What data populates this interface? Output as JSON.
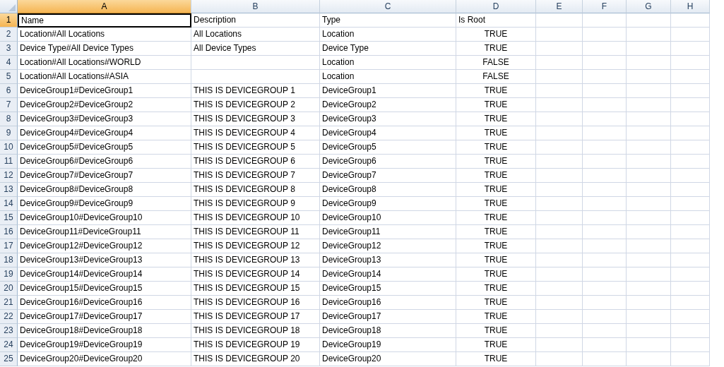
{
  "columns": [
    {
      "label": "A",
      "selected": true
    },
    {
      "label": "B",
      "selected": false
    },
    {
      "label": "C",
      "selected": false
    },
    {
      "label": "D",
      "selected": false
    },
    {
      "label": "E",
      "selected": false
    },
    {
      "label": "F",
      "selected": false
    },
    {
      "label": "G",
      "selected": false
    },
    {
      "label": "H",
      "selected": false
    }
  ],
  "rows": [
    {
      "number": "1",
      "selected": true,
      "cells": [
        "Name",
        "Description",
        "Type",
        "Is Root"
      ]
    },
    {
      "number": "2",
      "selected": false,
      "cells": [
        "Location#All Locations",
        "All Locations",
        "Location",
        "TRUE"
      ]
    },
    {
      "number": "3",
      "selected": false,
      "cells": [
        "Device Type#All Device Types",
        "All Device Types",
        "Device Type",
        "TRUE"
      ]
    },
    {
      "number": "4",
      "selected": false,
      "cells": [
        "Location#All Locations#WORLD",
        null,
        "Location",
        "FALSE"
      ]
    },
    {
      "number": "5",
      "selected": false,
      "cells": [
        "Location#All Locations#ASIA",
        null,
        "Location",
        "FALSE"
      ]
    },
    {
      "number": "6",
      "selected": false,
      "cells": [
        "DeviceGroup1#DeviceGroup1",
        "THIS IS DEVICEGROUP 1",
        "DeviceGroup1",
        "TRUE"
      ]
    },
    {
      "number": "7",
      "selected": false,
      "cells": [
        "DeviceGroup2#DeviceGroup2",
        "THIS IS DEVICEGROUP 2",
        "DeviceGroup2",
        "TRUE"
      ]
    },
    {
      "number": "8",
      "selected": false,
      "cells": [
        "DeviceGroup3#DeviceGroup3",
        "THIS IS DEVICEGROUP 3",
        "DeviceGroup3",
        "TRUE"
      ]
    },
    {
      "number": "9",
      "selected": false,
      "cells": [
        "DeviceGroup4#DeviceGroup4",
        "THIS IS DEVICEGROUP 4",
        "DeviceGroup4",
        "TRUE"
      ]
    },
    {
      "number": "10",
      "selected": false,
      "cells": [
        "DeviceGroup5#DeviceGroup5",
        "THIS IS DEVICEGROUP 5",
        "DeviceGroup5",
        "TRUE"
      ]
    },
    {
      "number": "11",
      "selected": false,
      "cells": [
        "DeviceGroup6#DeviceGroup6",
        "THIS IS DEVICEGROUP 6",
        "DeviceGroup6",
        "TRUE"
      ]
    },
    {
      "number": "12",
      "selected": false,
      "cells": [
        "DeviceGroup7#DeviceGroup7",
        "THIS IS DEVICEGROUP 7",
        "DeviceGroup7",
        "TRUE"
      ]
    },
    {
      "number": "13",
      "selected": false,
      "cells": [
        "DeviceGroup8#DeviceGroup8",
        "THIS IS DEVICEGROUP 8",
        "DeviceGroup8",
        "TRUE"
      ]
    },
    {
      "number": "14",
      "selected": false,
      "cells": [
        "DeviceGroup9#DeviceGroup9",
        "THIS IS DEVICEGROUP 9",
        "DeviceGroup9",
        "TRUE"
      ]
    },
    {
      "number": "15",
      "selected": false,
      "cells": [
        "DeviceGroup10#DeviceGroup10",
        "THIS IS DEVICEGROUP 10",
        "DeviceGroup10",
        "TRUE"
      ]
    },
    {
      "number": "16",
      "selected": false,
      "cells": [
        "DeviceGroup11#DeviceGroup11",
        "THIS IS DEVICEGROUP 11",
        "DeviceGroup11",
        "TRUE"
      ]
    },
    {
      "number": "17",
      "selected": false,
      "cells": [
        "DeviceGroup12#DeviceGroup12",
        "THIS IS DEVICEGROUP 12",
        "DeviceGroup12",
        "TRUE"
      ]
    },
    {
      "number": "18",
      "selected": false,
      "cells": [
        "DeviceGroup13#DeviceGroup13",
        "THIS IS DEVICEGROUP 13",
        "DeviceGroup13",
        "TRUE"
      ]
    },
    {
      "number": "19",
      "selected": false,
      "cells": [
        "DeviceGroup14#DeviceGroup14",
        "THIS IS DEVICEGROUP 14",
        "DeviceGroup14",
        "TRUE"
      ]
    },
    {
      "number": "20",
      "selected": false,
      "cells": [
        "DeviceGroup15#DeviceGroup15",
        "THIS IS DEVICEGROUP 15",
        "DeviceGroup15",
        "TRUE"
      ]
    },
    {
      "number": "21",
      "selected": false,
      "cells": [
        "DeviceGroup16#DeviceGroup16",
        "THIS IS DEVICEGROUP 16",
        "DeviceGroup16",
        "TRUE"
      ]
    },
    {
      "number": "22",
      "selected": false,
      "cells": [
        "DeviceGroup17#DeviceGroup17",
        "THIS IS DEVICEGROUP 17",
        "DeviceGroup17",
        "TRUE"
      ]
    },
    {
      "number": "23",
      "selected": false,
      "cells": [
        "DeviceGroup18#DeviceGroup18",
        "THIS IS DEVICEGROUP 18",
        "DeviceGroup18",
        "TRUE"
      ]
    },
    {
      "number": "24",
      "selected": false,
      "cells": [
        "DeviceGroup19#DeviceGroup19",
        "THIS IS DEVICEGROUP 19",
        "DeviceGroup19",
        "TRUE"
      ]
    },
    {
      "number": "25",
      "selected": false,
      "cells": [
        "DeviceGroup20#DeviceGroup20",
        "THIS IS DEVICEGROUP 20",
        "DeviceGroup20",
        "TRUE"
      ]
    }
  ]
}
